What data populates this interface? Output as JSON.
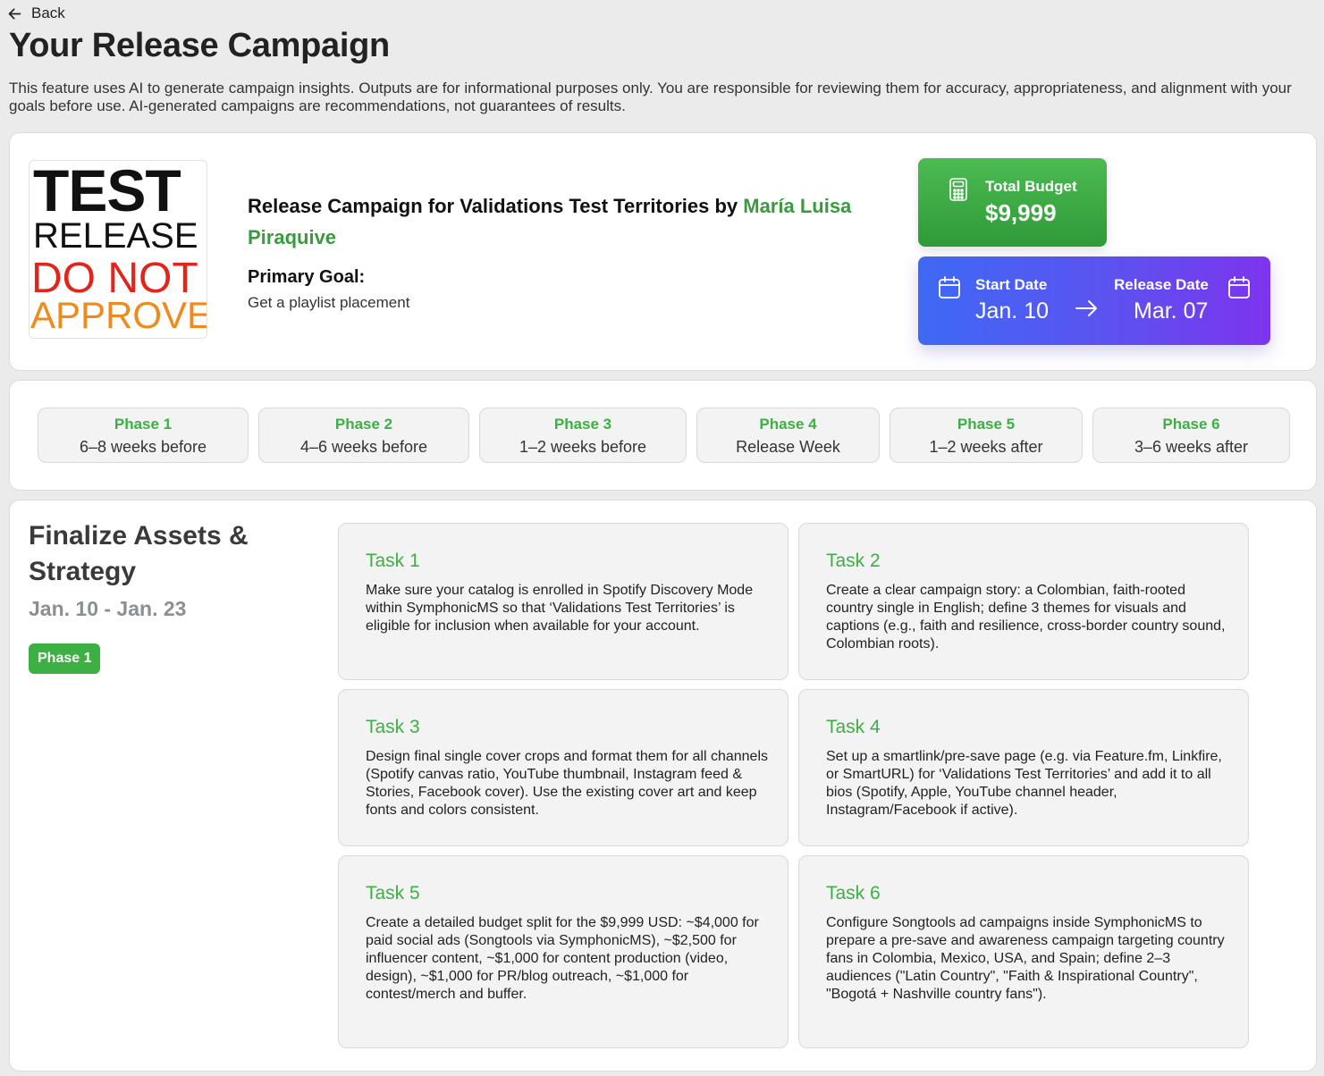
{
  "nav": {
    "back_label": "Back"
  },
  "page": {
    "title": "Your Release Campaign",
    "disclaimer": "This feature uses AI to generate campaign insights. Outputs are for informational purposes only. You are responsible for reviewing them for accuracy, appropriateness, and alignment with your goals before use. AI-generated campaigns are recommendations, not guarantees of results."
  },
  "release": {
    "cover_lines": [
      "TEST",
      "RELEASE",
      "DO NOT",
      "APPROVE"
    ],
    "title_prefix": "Release Campaign for Validations Test Territories by ",
    "artist": "María Luisa Piraquive",
    "primary_goal_label": "Primary Goal:",
    "primary_goal": "Get a playlist placement"
  },
  "budget": {
    "label": "Total Budget",
    "value": "$9,999",
    "icon": "calculator-icon"
  },
  "dates": {
    "start_label": "Start Date",
    "start_value": "Jan. 10",
    "release_label": "Release Date",
    "release_value": "Mar. 07",
    "icon": "calendar-icon"
  },
  "phases": [
    {
      "name": "Phase 1",
      "when": "6–8 weeks before"
    },
    {
      "name": "Phase 2",
      "when": "4–6 weeks before"
    },
    {
      "name": "Phase 3",
      "when": "1–2 weeks before"
    },
    {
      "name": "Phase 4",
      "when": "Release Week"
    },
    {
      "name": "Phase 5",
      "when": "1–2 weeks after"
    },
    {
      "name": "Phase 6",
      "when": "3–6 weeks after"
    }
  ],
  "active_phase": {
    "title": "Finalize Assets & Strategy",
    "range": "Jan. 10 - Jan. 23",
    "badge": "Phase 1",
    "tasks": [
      {
        "title": "Task 1",
        "text": "Make sure your catalog is enrolled in Spotify Discovery Mode within SymphonicMS so that ‘Validations Test Territories’ is eligible for inclusion when available for your account."
      },
      {
        "title": "Task 2",
        "text": "Create a clear campaign story: a Colombian, faith-rooted country single in English; define 3 themes for visuals and captions (e.g., faith and resilience, cross-border country sound, Colombian roots)."
      },
      {
        "title": "Task 3",
        "text": "Design final single cover crops and format them for all channels (Spotify canvas ratio, YouTube thumbnail, Instagram feed & Stories, Facebook cover). Use the existing cover art and keep fonts and colors consistent."
      },
      {
        "title": "Task 4",
        "text": "Set up a smartlink/pre-save page (e.g. via Feature.fm, Linkfire, or SmartURL) for ‘Validations Test Territories’ and add it to all bios (Spotify, Apple, YouTube channel header, Instagram/Facebook if active)."
      },
      {
        "title": "Task 5",
        "text": "Create a detailed budget split for the $9,999 USD: ~$4,000 for paid social ads (Songtools via SymphonicMS), ~$2,500 for influencer content, ~$1,000 for content production (video, design), ~$1,000 for PR/blog outreach, ~$1,000 for contest/merch and buffer."
      },
      {
        "title": "Task 6",
        "text": "Configure Songtools ad campaigns inside SymphonicMS to prepare a pre-save and awareness campaign targeting country fans in Colombia, Mexico, USA, and Spain; define 2–3 audiences (\"Latin Country\", \"Faith & Inspirational Country\", \"Bogotá + Nashville country fans\")."
      }
    ]
  },
  "colors": {
    "accent_green": "#3cb043",
    "budget_gradient": [
      "#4cbb52",
      "#2f9a38"
    ],
    "dates_gradient": [
      "#3e69f5",
      "#7d34ee"
    ]
  }
}
